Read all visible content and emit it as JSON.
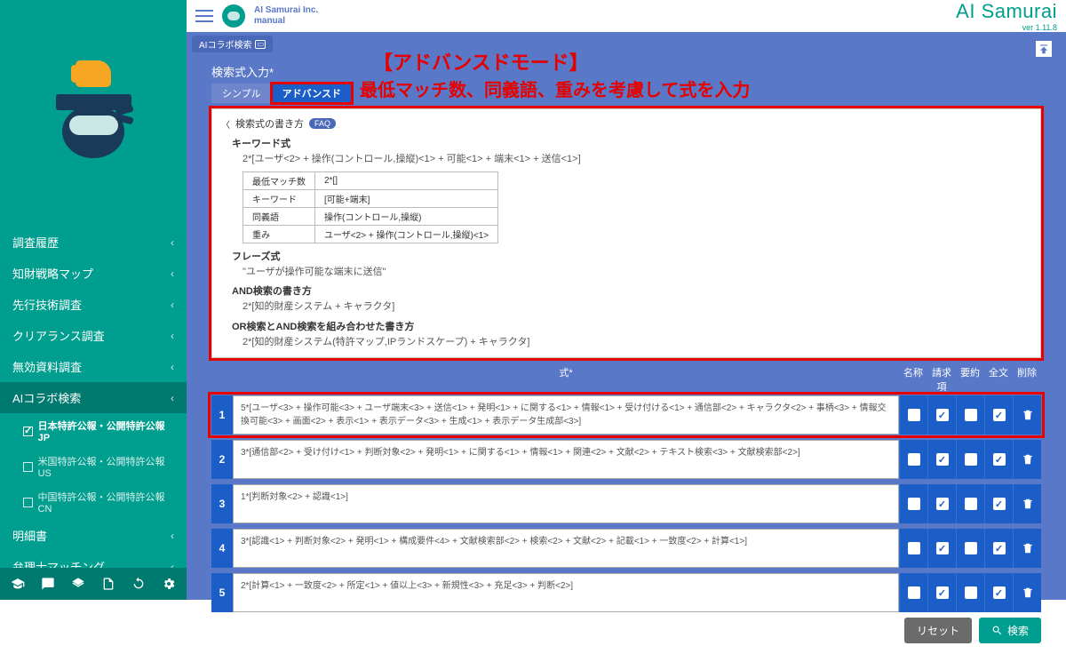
{
  "header": {
    "company": "AI Samurai Inc.",
    "account": "manual",
    "brand": "AI Samurai",
    "version": "ver 1.11.8"
  },
  "tab_chip": "AIコラボ検索",
  "sidebar": {
    "items": [
      {
        "label": "調査履歴"
      },
      {
        "label": "知財戦略マップ"
      },
      {
        "label": "先行技術調査"
      },
      {
        "label": "クリアランス調査"
      },
      {
        "label": "無効資料調査"
      },
      {
        "label": "AIコラボ検索",
        "active": true
      },
      {
        "label": "明細書"
      },
      {
        "label": "弁理士マッチング"
      }
    ],
    "sub_items": [
      {
        "label": "日本特許公報・公開特許公報 JP",
        "checked": true
      },
      {
        "label": "米国特許公報・公開特許公報 US",
        "checked": false
      },
      {
        "label": "中国特許公報・公開特許公報 CN",
        "checked": false
      }
    ]
  },
  "annotations": {
    "title": "【アドバンスドモード】",
    "subtitle": "最低マッチ数、同義語、重みを考慮して式を入力"
  },
  "page": {
    "title": "検索式入力*",
    "tab_simple": "シンプル",
    "tab_advanced": "アドバンスド"
  },
  "help": {
    "heading": "検索式の書き方",
    "faq": "FAQ",
    "kw_head": "キーワード式",
    "kw_example": "2*[ユーザ<2> + 操作(コントロール,操縦)<1> + 可能<1> + 端末<1> + 送信<1>]",
    "table": {
      "r1k": "最低マッチ数",
      "r1v": "2*[]",
      "r2k": "キーワード",
      "r2v": "[可能+端末]",
      "r3k": "同義語",
      "r3v": "操作(コントロール,操縦)",
      "r4k": "重み",
      "r4v": "ユーザ<2> + 操作(コントロール,操縦)<1>"
    },
    "phrase_head": "フレーズ式",
    "phrase_ex": "\"ユーザが操作可能な端末に送信\"",
    "and_head": "AND検索の書き方",
    "and_ex": "2*[知的財産システム + キャラクタ]",
    "orand_head": "OR検索とAND検索を組み合わせた書き方",
    "orand_ex": "2*[知的財産システム(特許マップ,IPランドスケープ) + キャラクタ]"
  },
  "grid": {
    "header_formula": "式*",
    "cols": [
      "名称",
      "請求項",
      "要約",
      "全文",
      "削除"
    ]
  },
  "rows": [
    {
      "n": "1",
      "v": "5*[ユーザ<3> + 操作可能<3> + ユーザ端末<3> + 送信<1> + 発明<1> + に関する<1> + 情報<1> + 受け付ける<1> + 通信部<2> + キャラクタ<2> + 事柄<3> + 情報交換可能<3> + 画面<2> + 表示<1> + 表示データ<3> + 生成<1> + 表示データ生成部<3>]",
      "c": [
        false,
        true,
        false,
        true
      ]
    },
    {
      "n": "2",
      "v": "3*[通信部<2> + 受け付け<1> + 判断対象<2> + 発明<1> + に関する<1> + 情報<1> + 関連<2> + 文献<2> + テキスト検索<3> + 文献検索部<2>]",
      "c": [
        false,
        true,
        false,
        true
      ]
    },
    {
      "n": "3",
      "v": "1*[判断対象<2> + 認識<1>]",
      "c": [
        false,
        true,
        false,
        true
      ]
    },
    {
      "n": "4",
      "v": "3*[認識<1> + 判断対象<2> + 発明<1> + 構成要件<4> + 文献検索部<2> + 検索<2> + 文献<2> + 記載<1> + 一致度<2> + 計算<1>]",
      "c": [
        false,
        true,
        false,
        true
      ]
    },
    {
      "n": "5",
      "v": "2*[計算<1> + 一致度<2> + 所定<1> + 値以上<3> + 新規性<3> + 充足<3> + 判断<2>]",
      "c": [
        false,
        true,
        false,
        true
      ]
    }
  ],
  "buttons": {
    "reset": "リセット",
    "search": "検索"
  }
}
